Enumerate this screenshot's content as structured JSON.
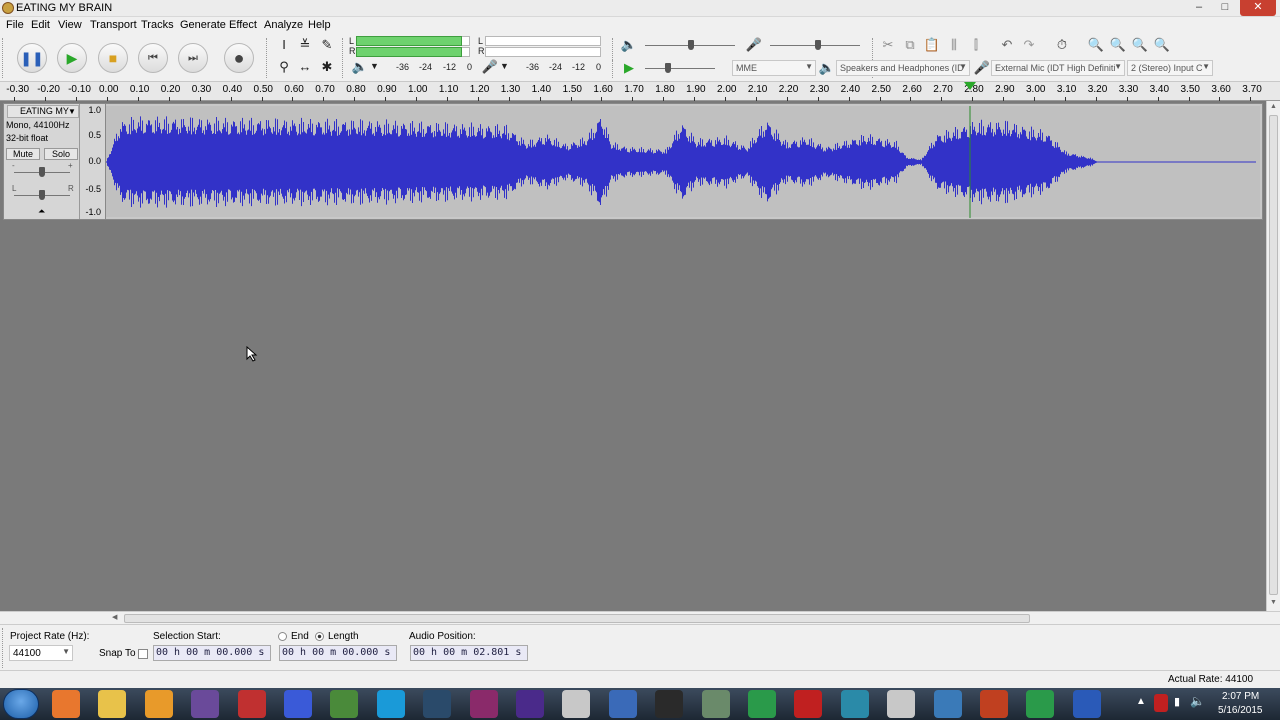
{
  "window": {
    "title": "EATING MY BRAIN",
    "controls": [
      "–",
      "□",
      "✕"
    ]
  },
  "menu": [
    "File",
    "Edit",
    "View",
    "Transport",
    "Tracks",
    "Generate",
    "Effect",
    "Analyze",
    "Help"
  ],
  "transport_icons": [
    "pause-icon",
    "play-icon",
    "stop-icon",
    "skip-start-icon",
    "skip-end-icon",
    "record-icon"
  ],
  "meters": {
    "playback_channels": [
      "L",
      "R"
    ],
    "record_channels": [
      "L",
      "R"
    ],
    "scale": [
      "-36",
      "-24",
      "-12",
      "0"
    ],
    "play_level": 0.95
  },
  "edit_icons": [
    "cut-icon",
    "copy-icon",
    "paste-icon",
    "trim-icon",
    "silence-icon",
    "undo-icon",
    "redo-icon",
    "sync-lock-icon",
    "zoom-in-icon",
    "zoom-out-icon",
    "fit-selection-icon",
    "fit-project-icon"
  ],
  "device": {
    "host": "MME",
    "output": "Speakers and Headphones (ID",
    "input": "External Mic (IDT High Definiti",
    "channels": "2 (Stereo) Input C"
  },
  "ruler": [
    "-0.30",
    "-0.20",
    "-0.10",
    "0.00",
    "0.10",
    "0.20",
    "0.30",
    "0.40",
    "0.50",
    "0.60",
    "0.70",
    "0.80",
    "0.90",
    "1.00",
    "1.10",
    "1.20",
    "1.30",
    "1.40",
    "1.50",
    "1.60",
    "1.70",
    "1.80",
    "1.90",
    "2.00",
    "2.10",
    "2.20",
    "2.30",
    "2.40",
    "2.50",
    "2.60",
    "2.70",
    "2.80",
    "2.90",
    "3.00",
    "3.10",
    "3.20",
    "3.30",
    "3.40",
    "3.50",
    "3.60",
    "3.70"
  ],
  "track": {
    "name": "EATING MY",
    "format_line1": "Mono, 44100Hz",
    "format_line2": "32-bit float",
    "mute": "Mute",
    "solo": "Solo",
    "gain_minus": "-",
    "gain_plus": "+",
    "pan_left": "L",
    "pan_right": "R",
    "vscale": [
      "1.0",
      "0.5",
      "0.0",
      "-0.5",
      "-1.0"
    ],
    "wave_color": "#3232c8"
  },
  "selection": {
    "project_rate_label": "Project Rate (Hz):",
    "project_rate": "44100",
    "snap_label": "Snap To",
    "selection_start_label": "Selection Start:",
    "end_label": "End",
    "length_label": "Length",
    "audio_position_label": "Audio Position:",
    "selection_start": "00 h 00 m 00.000 s",
    "length": "00 h 00 m 00.000 s",
    "audio_position": "00 h 00 m 02.801 s"
  },
  "status": {
    "actual_rate": "Actual Rate: 44100"
  },
  "taskbar": {
    "time": "2:07 PM",
    "date": "5/16/2015",
    "apps": [
      "firefox-icon",
      "explorer-icon",
      "media-player-icon",
      "game-icon",
      "dragon-icon",
      "app-icon",
      "minecraft-icon",
      "skype-icon",
      "steam-icon",
      "winrar-icon",
      "app-icon",
      "paint-icon",
      "notepad-icon",
      "audacity-icon",
      "gimp-icon",
      "camtasia-icon",
      "recorder-icon",
      "bird-icon",
      "gamepad-icon",
      "network-icon",
      "app-icon",
      "camtasia-icon",
      "help-icon"
    ]
  }
}
